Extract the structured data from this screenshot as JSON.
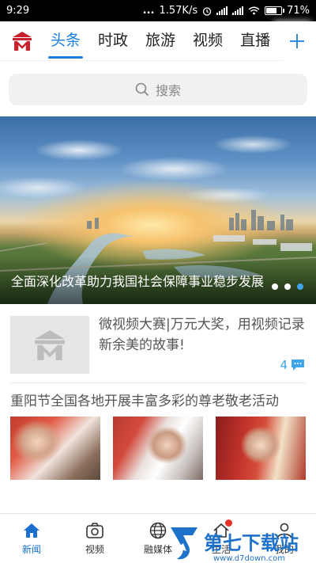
{
  "status_bar": {
    "time": "9:29",
    "dots": "...",
    "speed": "1.57K/s",
    "battery": "71%",
    "battery_level": 0.71
  },
  "top_nav": {
    "tabs": [
      {
        "label": "头条",
        "active": true
      },
      {
        "label": "时政",
        "active": false
      },
      {
        "label": "旅游",
        "active": false
      },
      {
        "label": "视频",
        "active": false
      },
      {
        "label": "直播",
        "active": false
      }
    ],
    "accent": "#1a7fe0"
  },
  "search": {
    "placeholder": "搜索"
  },
  "banner": {
    "caption": "全面深化改革助力我国社会保障事业稳步发展",
    "page_count": 3,
    "active_index": 2
  },
  "article1": {
    "title": "微视频大赛|万元大奖，用视频记录新余美的故事!",
    "comment_count": "4"
  },
  "article2": {
    "title": "重阳节全国各地开展丰富多彩的尊老敬老活动"
  },
  "bottom_nav": {
    "items": [
      {
        "label": "新闻",
        "icon": "home-icon",
        "active": true
      },
      {
        "label": "视频",
        "icon": "camera-icon",
        "active": false
      },
      {
        "label": "融媒体",
        "icon": "globe-icon",
        "active": false
      },
      {
        "label": "生活",
        "icon": "house-icon",
        "active": false
      },
      {
        "label": "我的",
        "icon": "person-icon",
        "active": false
      }
    ],
    "accent": "#1a6fd0"
  },
  "watermark": {
    "text": "第七下载站",
    "url": "www.d7down.com"
  }
}
